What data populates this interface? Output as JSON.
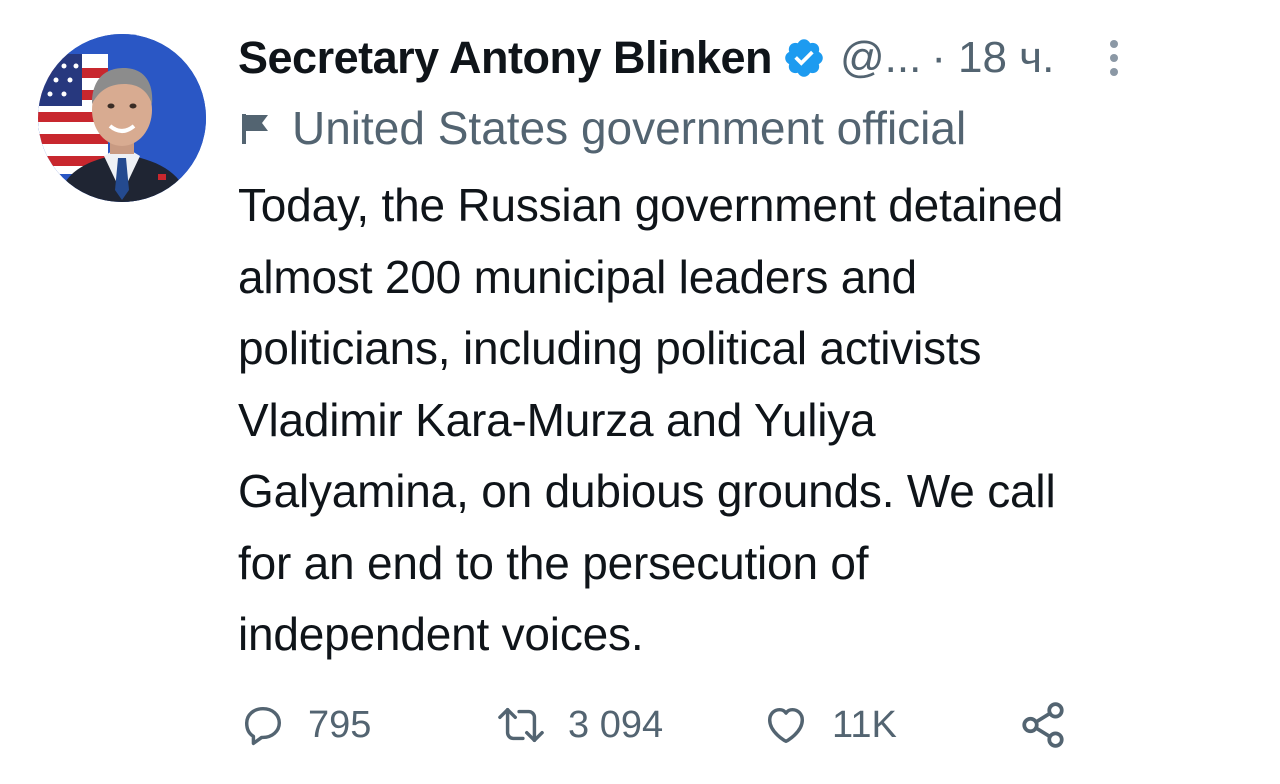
{
  "tweet": {
    "display_name": "Secretary Antony Blinken",
    "handle": "@...",
    "separator": "·",
    "time": "18 ч.",
    "label": "United States government official",
    "text": "Today, the Russian government detained\nalmost 200 municipal leaders and\npoliticians, including political activists\nVladimir Kara-Murza and Yuliya\nGalyamina, on dubious grounds. We call\nfor an end to the persecution of\nindependent voices.",
    "verified_icon": "verified-badge-icon",
    "label_icon": "flag-icon"
  },
  "actions": {
    "replies": "795",
    "retweets": "3 094",
    "likes": "11K",
    "reply_icon": "reply-icon",
    "retweet_icon": "retweet-icon",
    "like_icon": "heart-icon",
    "share_icon": "share-icon"
  },
  "colors": {
    "text_primary": "#0f1419",
    "text_secondary": "#536471",
    "verified_blue": "#1d9bf0"
  }
}
